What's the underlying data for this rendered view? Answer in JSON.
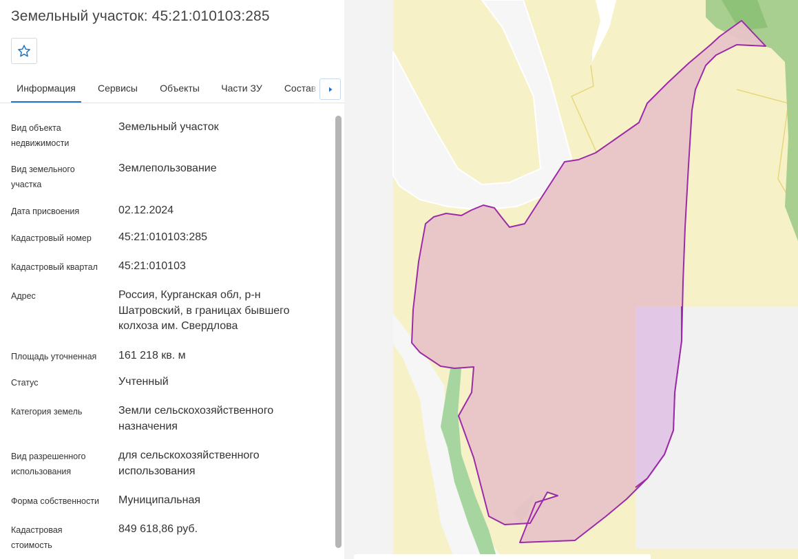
{
  "page": {
    "title": "Земельный участок: 45:21:010103:285"
  },
  "favorite": {
    "icon": "star-outline-icon"
  },
  "tabs": [
    {
      "label": "Информация",
      "active": true
    },
    {
      "label": "Сервисы"
    },
    {
      "label": "Объекты"
    },
    {
      "label": "Части ЗУ"
    },
    {
      "label": "Состав"
    }
  ],
  "tab_scroll": {
    "icon": "chevron-right-icon"
  },
  "info": [
    {
      "label": "Вид объекта недвижимости",
      "value": "Земельный участок"
    },
    {
      "label": "Вид земельного участка",
      "value": "Землепользование"
    },
    {
      "label": "Дата присвоения",
      "value": "02.12.2024"
    },
    {
      "label": "Кадастровый номер",
      "value": "45:21:010103:285"
    },
    {
      "label": "Кадастровый квартал",
      "value": "45:21:010103"
    },
    {
      "label": "Адрес",
      "value": "Россия, Курганская обл, р-н Шатровский, в границах бывшего колхоза им. Свердлова"
    },
    {
      "label": "Площадь уточненная",
      "value": "161 218 кв. м"
    },
    {
      "label": "Статус",
      "value": "Учтенный"
    },
    {
      "label": "Категория земель",
      "value": "Земли сельскохозяйственного назначения"
    },
    {
      "label": "Вид разрешенного использования",
      "value": "для сельскохозяйственного использования"
    },
    {
      "label": "Форма собственности",
      "value": "Муниципальная"
    },
    {
      "label": "Кадастровая стоимость",
      "value": "849 618,86 руб."
    }
  ],
  "colors": {
    "accent": "#1f73c9",
    "parcel_fill": "#e8c3c8",
    "parcel_stroke": "#9b2aa8",
    "field_yellow": "#f7f1c8",
    "forest_green": "#9cc98a",
    "road_white": "#ffffff"
  }
}
